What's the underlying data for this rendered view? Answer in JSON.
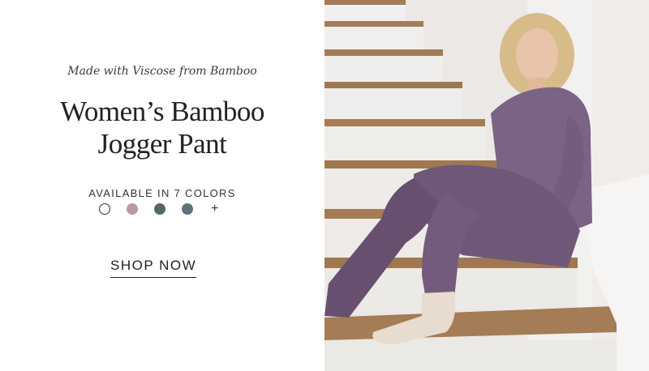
{
  "promo": {
    "tagline": "Made with Viscose from Bamboo",
    "title_line1": "Women’s Bamboo",
    "title_line2": "Jogger Pant",
    "availability": "AVAILABLE IN 7 COLORS",
    "more_colors": "+",
    "cta": "SHOP NOW"
  },
  "colors": {
    "swatch_white": "#ffffff",
    "swatch_mauve": "#b79aa7",
    "swatch_green": "#55695e",
    "swatch_slate": "#5b7276",
    "pants": "#6e5777",
    "stair_tread": "#a47c55",
    "wall": "#f1efed"
  },
  "image": {
    "subject": "woman in purple bamboo loungewear sitting on stairs"
  }
}
